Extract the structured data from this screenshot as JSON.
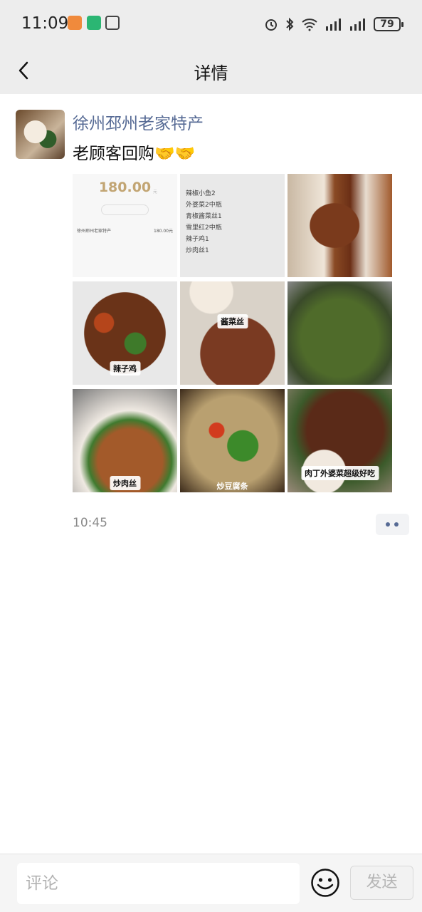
{
  "status_bar": {
    "time": "11:09",
    "battery": "79"
  },
  "nav": {
    "title": "详情"
  },
  "post": {
    "author": "徐州邳州老家特产",
    "text": "老顾客回购🤝🤝",
    "time": "10:45",
    "images": [
      {
        "type": "receipt",
        "amount": "180.00",
        "unit": "元",
        "merchant": "徐州邳州老家特产",
        "row_amount": "180.00元"
      },
      {
        "type": "order-list",
        "lines": [
          "辣椒小鱼2",
          "外婆菜2中瓶",
          "青椒酱菜丝1",
          "雪里红2中瓶",
          "辣子鸡1",
          "炒肉丝1"
        ]
      },
      {
        "type": "photo",
        "caption": ""
      },
      {
        "type": "photo",
        "caption": "辣子鸡"
      },
      {
        "type": "photo",
        "caption": "酱菜丝"
      },
      {
        "type": "photo",
        "caption": ""
      },
      {
        "type": "photo",
        "caption": "炒肉丝"
      },
      {
        "type": "photo",
        "caption": "炒豆腐条"
      },
      {
        "type": "photo",
        "caption": "肉丁外婆菜超级好吃"
      }
    ]
  },
  "comment_bar": {
    "placeholder": "评论",
    "send_label": "发送"
  },
  "icons": {
    "back": "chevron-left-icon",
    "more": "more-dots-icon",
    "emoji": "smiley-icon"
  },
  "colors": {
    "link": "#576b95",
    "background": "#ededed"
  }
}
